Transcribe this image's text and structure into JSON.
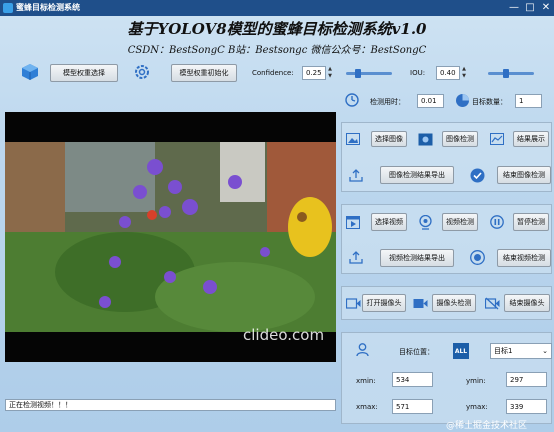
{
  "window": {
    "title": "蜜蜂目标检测系统",
    "minimize": "—",
    "maximize": "□",
    "close": "✕"
  },
  "header": {
    "title": "基于YOLOV8模型的蜜蜂目标检测系统v1.0",
    "subtitle": "CSDN：BestSongC   B站：Bestsongc   微信公众号：BestSongC"
  },
  "toolbar": {
    "select_weights": "模型权重选择",
    "init_weights": "模型权重初始化",
    "confidence_label": "Confidence:",
    "confidence_value": "0.25",
    "iou_label": "IOU:",
    "iou_value": "0.40",
    "confidence_fraction": 0.25,
    "iou_fraction": 0.4
  },
  "stats": {
    "time_label": "检测用时：",
    "time_value": "0.01",
    "count_label": "目标数量：",
    "count_value": "1"
  },
  "image_section": {
    "select": "选择图像",
    "detect": "图像检测",
    "show": "结果展示",
    "export": "图像检测结果导出",
    "stop": "结束图像检测"
  },
  "video_section": {
    "select": "选择视频",
    "detect": "视频检测",
    "pause": "暂停检测",
    "export": "视频检测结果导出",
    "stop": "结束视频检测"
  },
  "camera_section": {
    "open": "打开摄像头",
    "detect": "摄像头检测",
    "stop": "结束摄像头"
  },
  "target": {
    "position_label": "目标位置：",
    "selected": "目标1",
    "xmin_label": "xmin:",
    "xmin": "534",
    "ymin_label": "ymin:",
    "ymin": "297",
    "xmax_label": "xmax:",
    "xmax": "571",
    "ymax_label": "ymax:",
    "ymax": "339"
  },
  "video": {
    "watermark": "clideo.com"
  },
  "status": {
    "text": "正在检测视频！！！"
  },
  "footer": {
    "watermark": "@稀土掘金技术社区"
  },
  "colors": {
    "accent": "#2f6fc4",
    "titlebar": "#1f4f8a"
  }
}
